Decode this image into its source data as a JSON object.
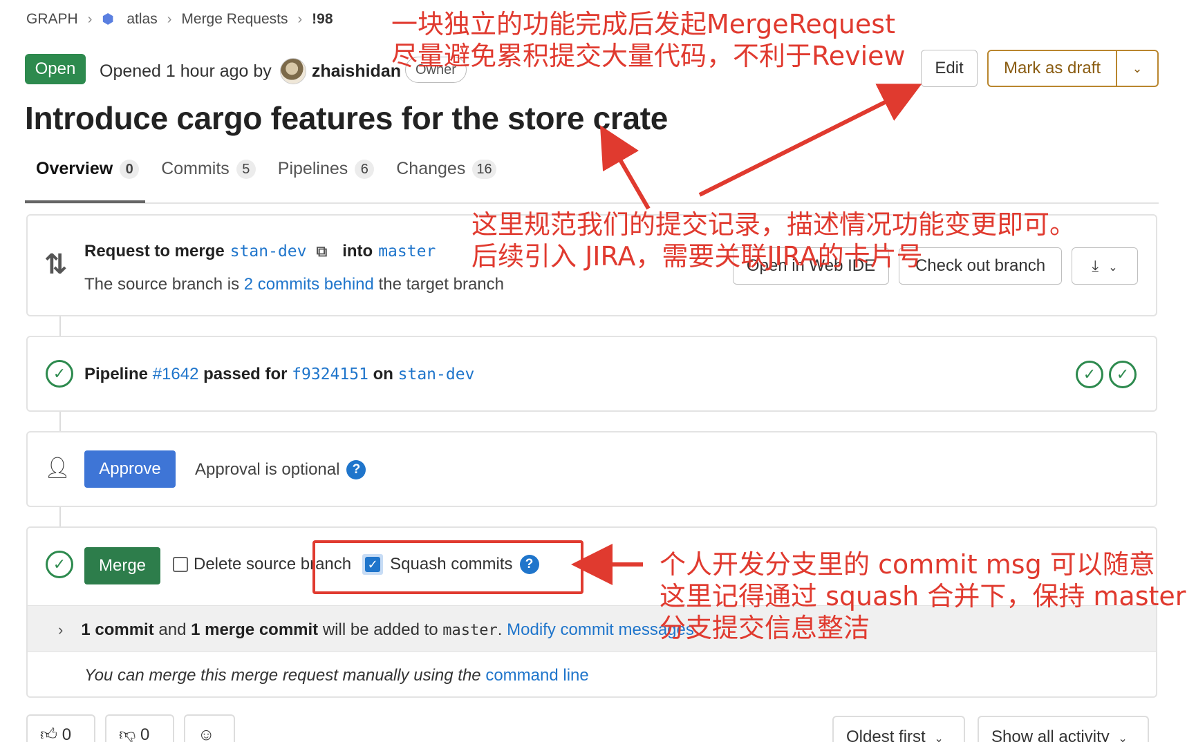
{
  "breadcrumb": {
    "group": "GRAPH",
    "project": "atlas",
    "section": "Merge Requests",
    "id": "!98"
  },
  "header": {
    "status": "Open",
    "opened_text": "Opened 1 hour ago by",
    "author": "zhaishidan",
    "role": "Owner",
    "edit_label": "Edit",
    "draft_label": "Mark as draft",
    "title": "Introduce cargo features for the store crate"
  },
  "tabs": [
    {
      "label": "Overview",
      "count": "0"
    },
    {
      "label": "Commits",
      "count": "5"
    },
    {
      "label": "Pipelines",
      "count": "6"
    },
    {
      "label": "Changes",
      "count": "16"
    }
  ],
  "request": {
    "prefix": "Request to merge",
    "source": "stan-dev",
    "into": "into",
    "target": "master",
    "behind_pre": "The source branch is",
    "behind_link": "2 commits behind",
    "behind_post": "the target branch",
    "web_ide": "Open in Web IDE",
    "checkout": "Check out branch"
  },
  "pipeline": {
    "pre": "Pipeline",
    "id": "#1642",
    "mid": "passed for",
    "sha": "f9324151",
    "on": "on",
    "branch": "stan-dev"
  },
  "approval": {
    "button": "Approve",
    "text": "Approval is optional",
    "help": "?"
  },
  "merge": {
    "button": "Merge",
    "delete_source": "Delete source branch",
    "squash": "Squash commits",
    "help": "?",
    "c1": "1 commit",
    "and": "and",
    "c2": "1 merge commit",
    "will": "will be added to",
    "target": "master",
    "dot": ".",
    "modify": "Modify commit messages",
    "manual_pre": "You can merge this merge request manually using the",
    "manual_link": "command line"
  },
  "reactions": {
    "thumbs_up": "0",
    "thumbs_down": "0"
  },
  "sorting": {
    "order": "Oldest first",
    "filter": "Show all activity"
  },
  "annotations": {
    "top_line1": "一块独立的功能完成后发起MergeRequest",
    "top_line2": "尽量避免累积提交大量代码，不利于Review",
    "mid_line1": "这里规范我们的提交记录，描述情况功能变更即可。",
    "mid_line2": "后续引入 JIRA，需要关联JIRA的卡片号",
    "bot_line1": "个人开发分支里的 commit msg 可以随意",
    "bot_line2": "这里记得通过 squash 合并下，保持 master",
    "bot_line3": "分支提交信息整洁"
  },
  "colors": {
    "open_green": "#2d8a4e",
    "link_blue": "#1f75cb",
    "annotation_red": "#e03a2f",
    "draft_gold": "#b9862e"
  }
}
